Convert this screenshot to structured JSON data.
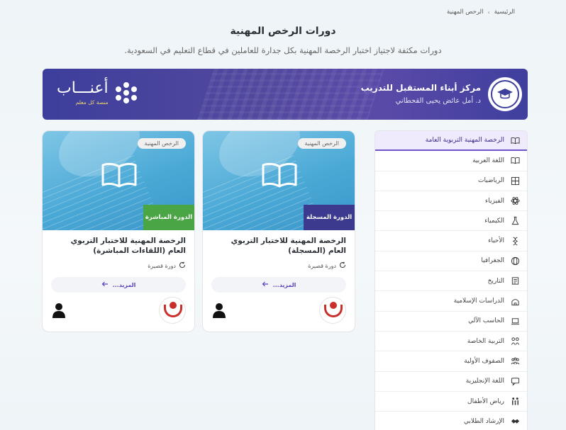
{
  "breadcrumb": {
    "home": "الرئيسية",
    "separator": "›",
    "current": "الرخص المهنية"
  },
  "page": {
    "title": "دورات الرخص المهنية",
    "subtitle": "دورات مكثفة لاجتياز اختبار الرخصة المهنية بكل جدارة للعاملين في قطاع التعليم في السعودية."
  },
  "banner": {
    "center_name": "مركز أبناء المستقبل للتدريب",
    "center_person": "د. أمل عائض يحيى القحطاني",
    "brand_name": "أعنـــاب",
    "brand_tagline": "منصة كل معلم"
  },
  "sidebar": {
    "items": [
      {
        "label": "الرخصة المهنية التربوية العامة",
        "icon": "book-icon",
        "active": true
      },
      {
        "label": "اللغة العربية",
        "icon": "book-icon",
        "active": false
      },
      {
        "label": "الرياضيات",
        "icon": "calculator-icon",
        "active": false
      },
      {
        "label": "الفيزياء",
        "icon": "atom-icon",
        "active": false
      },
      {
        "label": "الكيمياء",
        "icon": "flask-icon",
        "active": false
      },
      {
        "label": "الأحياء",
        "icon": "dna-icon",
        "active": false
      },
      {
        "label": "الجغرافيا",
        "icon": "globe-icon",
        "active": false
      },
      {
        "label": "التاريخ",
        "icon": "scroll-icon",
        "active": false
      },
      {
        "label": "الدراسات الإسلامية",
        "icon": "mosque-icon",
        "active": false
      },
      {
        "label": "الحاسب الآلي",
        "icon": "laptop-icon",
        "active": false
      },
      {
        "label": "التربية الخاصة",
        "icon": "puzzle-icon",
        "active": false
      },
      {
        "label": "الصفوف الأولية",
        "icon": "kids-icon",
        "active": false
      },
      {
        "label": "اللغة الإنجليزية",
        "icon": "chat-icon",
        "active": false
      },
      {
        "label": "رياض الأطفال",
        "icon": "family-icon",
        "active": false
      },
      {
        "label": "الإرشاد الطلابي",
        "icon": "handshake-icon",
        "active": false
      }
    ]
  },
  "cards": [
    {
      "tag": "الرخص المهنية",
      "ribbon": "الدورة المسجلة",
      "title": "الرخصة المهنية للاختبار التربوي العام (المسجلة)",
      "meta": "دورة قصيرة",
      "more": "المزيد..."
    },
    {
      "tag": "الرخص المهنية",
      "ribbon": "الدورة المباشرة",
      "title": "الرخصة المهنية للاختبار التربوي العام (اللقاءات المباشرة)",
      "meta": "دورة قصيرة",
      "more": "المزيد..."
    }
  ],
  "colors": {
    "accent": "#5a3fc0",
    "banner": "#4b4aa3",
    "ribbon_recorded": "#3b3a8f",
    "ribbon_live": "#4aa544"
  }
}
